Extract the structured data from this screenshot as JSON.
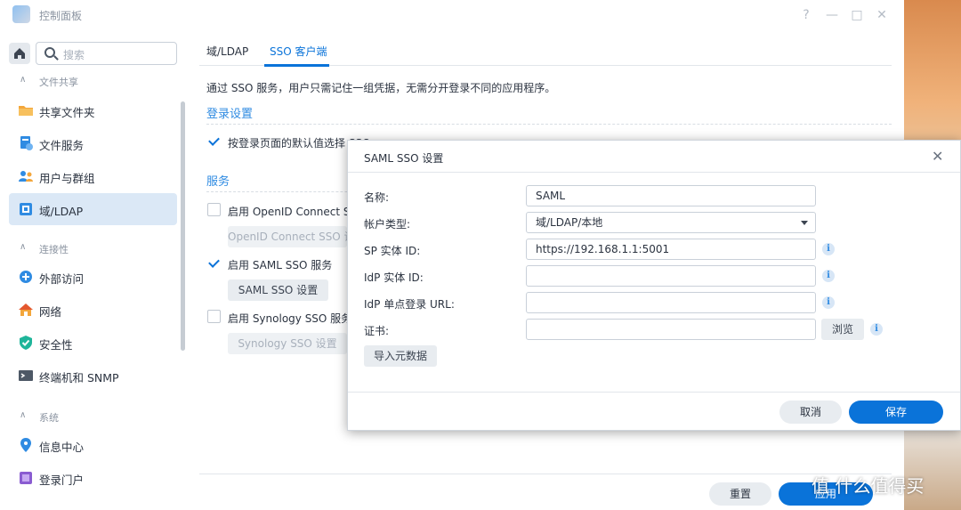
{
  "window": {
    "title": "控制面板",
    "controls": [
      "?",
      "—",
      "□",
      "✕"
    ]
  },
  "sidebar": {
    "search_placeholder": "搜索",
    "sections": [
      {
        "label": "文件共享"
      },
      {
        "label": "连接性"
      },
      {
        "label": "系统"
      }
    ],
    "items": [
      {
        "label": "共享文件夹",
        "icon": "folder-icon"
      },
      {
        "label": "文件服务",
        "icon": "file-service-icon"
      },
      {
        "label": "用户与群组",
        "icon": "users-icon"
      },
      {
        "label": "域/LDAP",
        "icon": "domain-icon",
        "active": true
      },
      {
        "label": "外部访问",
        "icon": "external-access-icon"
      },
      {
        "label": "网络",
        "icon": "network-icon"
      },
      {
        "label": "安全性",
        "icon": "shield-icon"
      },
      {
        "label": "终端机和 SNMP",
        "icon": "terminal-icon"
      },
      {
        "label": "信息中心",
        "icon": "info-center-icon"
      },
      {
        "label": "登录门户",
        "icon": "login-portal-icon"
      }
    ]
  },
  "content": {
    "tabs": [
      {
        "label": "域/LDAP",
        "active": false
      },
      {
        "label": "SSO 客户端",
        "active": true
      }
    ],
    "description": "通过 SSO 服务，用户只需记住一组凭据，无需分开登录不同的应用程序。",
    "login_settings": {
      "title": "登录设置",
      "default_sso_label": "按登录页面的默认值选择 SSO",
      "default_sso_checked": true
    },
    "services": {
      "title": "服务",
      "openid_label": "启用 OpenID Connect SSO 服务",
      "openid_checked": false,
      "openid_button": "OpenID Connect SSO 设置",
      "saml_label": "启用 SAML SSO 服务",
      "saml_checked": true,
      "saml_button": "SAML SSO 设置",
      "synology_label": "启用 Synology SSO 服务",
      "synology_checked": false,
      "synology_button": "Synology SSO 设置"
    },
    "reset_button": "重置",
    "apply_button": "应用"
  },
  "modal": {
    "title": "SAML SSO 设置",
    "fields": {
      "name_label": "名称:",
      "name_value": "SAML",
      "account_type_label": "帐户类型:",
      "account_type_value": "域/LDAP/本地",
      "sp_entity_label": "SP 实体 ID:",
      "sp_entity_value": "https://192.168.1.1:5001",
      "idp_entity_label": "IdP 实体 ID:",
      "idp_entity_value": "",
      "idp_sso_url_label": "IdP 单点登录 URL:",
      "idp_sso_url_value": "",
      "cert_label": "证书:",
      "cert_value": ""
    },
    "browse_button": "浏览",
    "import_button": "导入元数据",
    "cancel_button": "取消",
    "save_button": "保存"
  },
  "watermark": "值 什么值得买",
  "colors": {
    "accent": "#0a73d9",
    "section_title": "#2f8be2",
    "active_nav_bg": "#dbe8f6"
  }
}
